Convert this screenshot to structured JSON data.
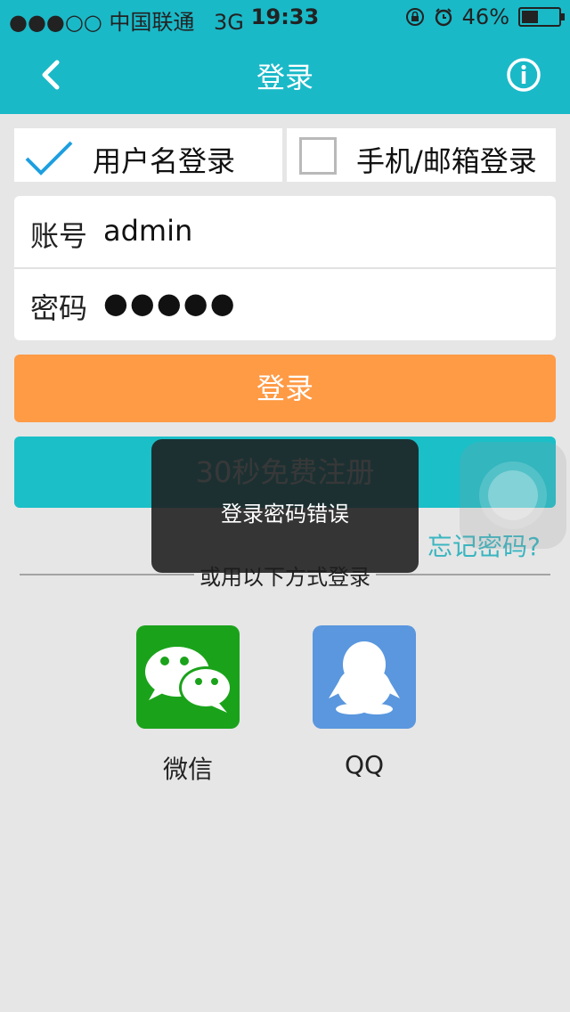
{
  "status_bar": {
    "signal": "●●●○○",
    "carrier": "中国联通",
    "network": "3G",
    "time": "19:33",
    "battery_percent": "46%",
    "battery_level": 0.46
  },
  "nav": {
    "title": "登录",
    "back_icon": "chevron-left-icon",
    "info_icon": "info-icon"
  },
  "tabs": [
    {
      "label": "用户名登录",
      "selected": true
    },
    {
      "label": "手机/邮箱登录",
      "selected": false
    }
  ],
  "form": {
    "account_label": "账号",
    "account_value": "admin",
    "password_label": "密码",
    "password_value": "●●●●●"
  },
  "buttons": {
    "login": "登录",
    "register": "30秒免费注册"
  },
  "forgot": "忘记密码?",
  "divider": "或用以下方式登录",
  "social": [
    {
      "label": "微信",
      "icon": "wechat-icon",
      "color": "#1aa31a"
    },
    {
      "label": "QQ",
      "icon": "qq-icon",
      "color": "#5a97de"
    }
  ],
  "toast": {
    "message": "登录密码错误"
  },
  "colors": {
    "header": "#1ab9c8",
    "login_button": "#ff9a45",
    "register_button": "#1bbfc8",
    "link": "#39b5c0"
  }
}
